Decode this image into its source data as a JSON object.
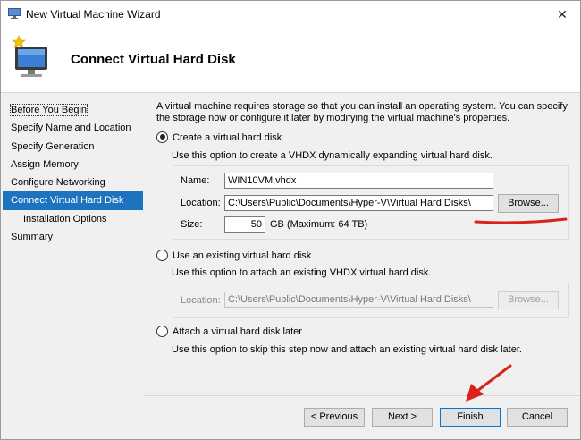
{
  "window": {
    "title": "New Virtual Machine Wizard",
    "close_glyph": "✕"
  },
  "header": {
    "title": "Connect Virtual Hard Disk"
  },
  "nav": {
    "items": [
      {
        "label": "Before You Begin"
      },
      {
        "label": "Specify Name and Location"
      },
      {
        "label": "Specify Generation"
      },
      {
        "label": "Assign Memory"
      },
      {
        "label": "Configure Networking"
      },
      {
        "label": "Connect Virtual Hard Disk"
      },
      {
        "label": "Installation Options"
      },
      {
        "label": "Summary"
      }
    ]
  },
  "main": {
    "description": "A virtual machine requires storage so that you can install an operating system. You can specify the storage now or configure it later by modifying the virtual machine's properties.",
    "create": {
      "label": "Create a virtual hard disk",
      "hint": "Use this option to create a VHDX dynamically expanding virtual hard disk.",
      "name_label": "Name:",
      "name_value": "WIN10VM.vhdx",
      "location_label": "Location:",
      "location_value": "C:\\Users\\Public\\Documents\\Hyper-V\\Virtual Hard Disks\\",
      "browse_label": "Browse...",
      "size_label": "Size:",
      "size_value": "50",
      "size_unit": "GB (Maximum: 64 TB)"
    },
    "existing": {
      "label": "Use an existing virtual hard disk",
      "hint": "Use this option to attach an existing VHDX virtual hard disk.",
      "location_label": "Location:",
      "location_value": "C:\\Users\\Public\\Documents\\Hyper-V\\Virtual Hard Disks\\",
      "browse_label": "Browse..."
    },
    "later": {
      "label": "Attach a virtual hard disk later",
      "hint": "Use this option to skip this step now and attach an existing virtual hard disk later."
    }
  },
  "footer": {
    "previous_label": "< Previous",
    "next_label": "Next >",
    "finish_label": "Finish",
    "cancel_label": "Cancel"
  },
  "colors": {
    "nav_active": "#1e73be",
    "annotation_red": "#d9221c"
  }
}
